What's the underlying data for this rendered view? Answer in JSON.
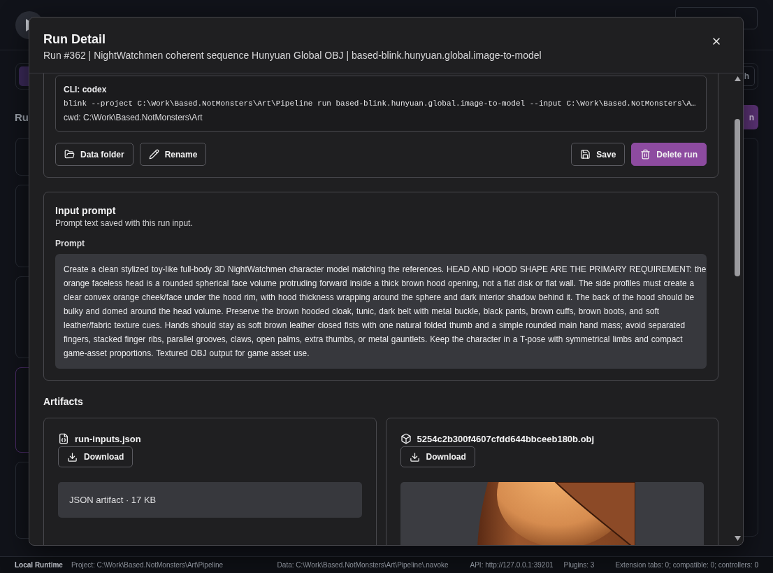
{
  "app": {
    "section_heading": "Ru",
    "toolbar_button": "h",
    "primary_button": "n",
    "run_cards": [
      {
        "selected": false
      },
      {
        "selected": false
      },
      {
        "selected": false
      },
      {
        "selected": true
      },
      {
        "selected": false
      }
    ]
  },
  "modal": {
    "title": "Run Detail",
    "subtitle": "Run #362 | NightWatchmen coherent sequence Hunyuan Global OBJ | based-blink.hunyuan.global.image-to-model"
  },
  "command": {
    "cli_label": "CLI: codex",
    "command_line": "blink --project C:\\Work\\Based.NotMonsters\\Art\\Pipeline run based-blink.hunyuan.global.image-to-model --input C:\\Work\\Based.NotMonsters\\A…",
    "cwd": "cwd: C:\\Work\\Based.NotMonsters\\Art"
  },
  "left_actions": [
    {
      "kind": "folder",
      "label": "Data folder",
      "primary": false
    },
    {
      "kind": "rename",
      "label": "Rename",
      "primary": false
    }
  ],
  "right_actions": [
    {
      "kind": "save",
      "label": "Save",
      "primary": false
    },
    {
      "kind": "delete",
      "label": "Delete run",
      "primary": true
    }
  ],
  "input_prompt": {
    "title": "Input prompt",
    "description": "Prompt text saved with this run input.",
    "field_label": "Prompt",
    "text": "Create a clean stylized toy-like full-body 3D NightWatchmen character model matching the references. HEAD AND HOOD SHAPE ARE THE PRIMARY REQUIREMENT: the orange faceless head is a rounded spherical face volume protruding forward inside a thick brown hood opening, not a flat disk or flat wall. The side profiles must create a clear convex orange cheek/face under the hood rim, with hood thickness wrapping around the sphere and dark interior shadow behind it. The back of the hood should be bulky and domed around the head volume. Preserve the brown hooded cloak, tunic, dark belt with metal buckle, black pants, brown cuffs, brown boots, and soft leather/fabric texture cues. Hands should stay as soft brown leather closed fists with one natural folded thumb and a simple rounded main hand mass; avoid separated fingers, stacked finger ribs, parallel grooves, claws, open palms, extra thumbs, or metal gauntlets. Keep the character in a T-pose with symmetrical limbs and compact game-asset proportions. Textured OBJ output for game asset use."
  },
  "artifacts": {
    "title": "Artifacts",
    "items": [
      {
        "kind": "json",
        "name": "run-inputs.json",
        "download": "Download",
        "summary": "JSON artifact · 17 KB"
      },
      {
        "kind": "model",
        "name": "5254c2b300f4607cfdd644bbceeb180b.obj",
        "download": "Download"
      }
    ]
  },
  "status_bar": {
    "runtime": "Local Runtime",
    "project": "Project: C:\\Work\\Based.NotMonsters\\Art\\Pipeline",
    "data": "Data: C:\\Work\\Based.NotMonsters\\Art\\Pipeline\\.navoke",
    "api": "API: http://127.0.0.1:39201",
    "plugins": "Plugins: 3",
    "extensions": "Extension tabs: 0; compatible: 0; controllers: 0"
  }
}
